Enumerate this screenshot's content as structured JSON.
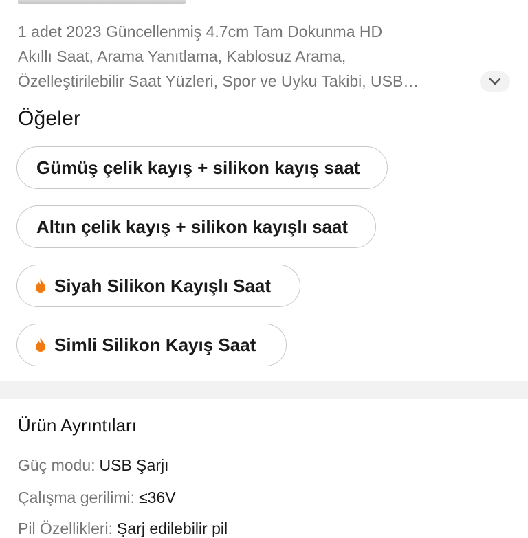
{
  "product": {
    "title_lines": [
      "1 adet 2023 Güncellenmiş 4.7cm Tam Dokunma HD",
      "Akıllı Saat, Arama Yanıtlama, Kablosuz Arama,",
      "Özelleştirilebilir Saat Yüzleri, Spor ve Uyku Takibi, USB…"
    ]
  },
  "items_section": {
    "title": "Öğeler",
    "options": [
      {
        "label": "Gümüş çelik kayış + silikon kayış saat",
        "hot": false
      },
      {
        "label": "Altın çelik kayış + silikon kayışlı saat",
        "hot": false
      },
      {
        "label": "Siyah Silikon Kayışlı Saat",
        "hot": true,
        "icon": "flame-icon"
      },
      {
        "label": "Simli Silikon Kayış Saat",
        "hot": true,
        "icon": "flame-icon"
      }
    ]
  },
  "details_section": {
    "title": "Ürün Ayrıntıları",
    "rows": [
      {
        "key": "Güç modu:",
        "value": "USB Şarjı"
      },
      {
        "key": "Çalışma gerilimi:",
        "value": "≤36V"
      },
      {
        "key": "Pil Özellikleri:",
        "value": "Şarj edilebilir pil"
      }
    ]
  },
  "icons": {
    "expand": "chevron-down-icon",
    "hot": "flame-icon"
  },
  "colors": {
    "accent_flame": "#f07a12",
    "muted_text": "#757575",
    "divider": "#f2f2f2"
  }
}
